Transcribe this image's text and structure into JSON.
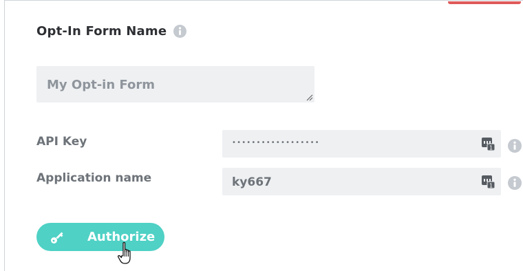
{
  "form": {
    "title": "Opt-In Form Name",
    "name_placeholder": "My Opt-in Form"
  },
  "fields": {
    "api_key": {
      "label": "API Key",
      "value": "••••••••••••••••••"
    },
    "app_name": {
      "label": "Application name",
      "value": "ky667"
    }
  },
  "actions": {
    "authorize_label": "Authorize"
  },
  "colors": {
    "accent": "#4fd1c5",
    "top_bar": "#e05a5a",
    "input_bg": "#eef0f2"
  },
  "icons": {
    "title_info": "info-icon",
    "password_manager": "keypass-icon",
    "field_info": "info-icon",
    "authorize": "key-icon",
    "cursor": "hand-pointer-icon"
  }
}
